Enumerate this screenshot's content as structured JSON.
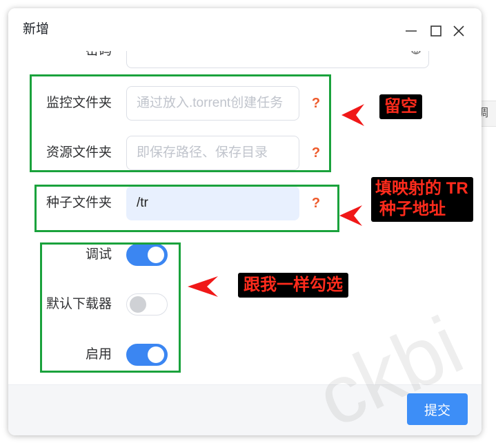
{
  "window": {
    "title": "新增",
    "controls": {
      "minimize": "minimize-icon",
      "maximize": "maximize-icon",
      "close": "close-icon"
    }
  },
  "form": {
    "password": {
      "label": "密码",
      "toggle_icon": "eye-icon"
    },
    "watch_folder": {
      "label": "监控文件夹",
      "placeholder": "通过放入.torrent创建任务",
      "help": "?"
    },
    "resource_folder": {
      "label": "资源文件夹",
      "placeholder": "即保存路径、保存目录",
      "help": "?"
    },
    "torrent_folder": {
      "label": "种子文件夹",
      "value": "/tr",
      "help": "?"
    },
    "debug": {
      "label": "调试",
      "checked": true
    },
    "default_downloader": {
      "label": "默认下载器",
      "checked": false
    },
    "enabled": {
      "label": "启用",
      "checked": true
    }
  },
  "footer": {
    "submit_label": "提交"
  },
  "annotations": {
    "leave_empty": {
      "text": "留空"
    },
    "torrent_path": {
      "line1": "填映射的 TR",
      "line2": "种子地址"
    },
    "check_like_me": {
      "text": "跟我一样勾选"
    }
  },
  "watermark": {
    "text": "ckbi"
  },
  "background_window": {
    "partial_text": "调"
  },
  "colors": {
    "accent": "#3d8ef7",
    "toggle_on": "#3b86f2",
    "help_icon": "#ee5a2b",
    "annotation_box": "#1aa23c",
    "annotation_text": "#ff2b1c",
    "annotation_arrow": "#f01818",
    "autofill_bg": "#e8f0fe"
  }
}
